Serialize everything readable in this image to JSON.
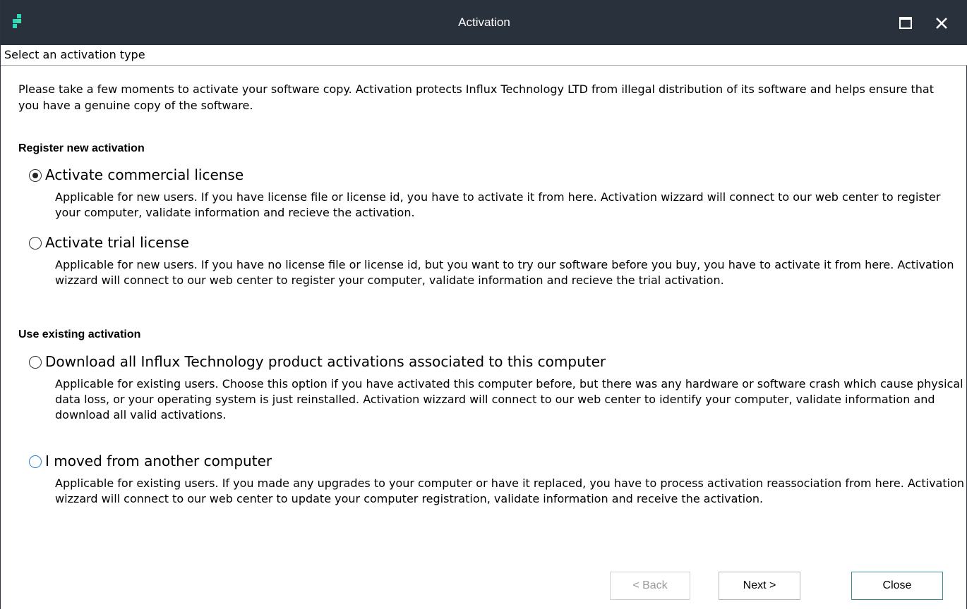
{
  "window": {
    "title": "Activation",
    "logo_icon": "app-logo-icon",
    "maximize_icon": "maximize-icon",
    "close_icon": "close-icon"
  },
  "header": {
    "subtitle": "Select an activation type"
  },
  "intro": {
    "text": "Please take a few moments to activate your software copy. Activation protects Influx Technology LTD from illegal distribution of its software and helps ensure that you have a genuine copy of the software."
  },
  "sections": {
    "register": {
      "title": "Register new activation",
      "options": [
        {
          "label": "Activate commercial license",
          "description": "Applicable for new users. If you have license file or license id, you have to activate it from here. Activation wizzard will connect to our web center to register your computer, validate information and recieve the activation.",
          "checked": true
        },
        {
          "label": "Activate trial license",
          "description": "Applicable for new users. If you have no license file or license id, but you want to try our software before you buy, you have to activate it from here. Activation wizzard will connect to our web center to register your computer, validate information and recieve the trial activation.",
          "checked": false
        }
      ]
    },
    "existing": {
      "title": "Use existing activation",
      "options": [
        {
          "label": "Download all Influx Technology product activations associated to this computer",
          "description": "Applicable for existing users. Choose this option if you have activated this computer before, but there was any hardware or software crash which cause physical data loss, or your operating system is just reinstalled. Activation wizzard will connect to our web center to identify your computer, validate information and download all valid activations.",
          "checked": false
        },
        {
          "label": "I moved from another computer",
          "description": "Applicable for existing users. If you made any upgrades to your computer or have it replaced, you have to process activation reassociation from here. Activation wizzard will connect to our web center to update your computer registration, validate information and receive the activation.",
          "checked": false,
          "focused": true
        }
      ]
    }
  },
  "buttons": {
    "back": "< Back",
    "next": "Next >",
    "close": "Close"
  },
  "colors": {
    "titlebar": "#28313c",
    "logo": "#2fd6b8",
    "focus": "#2b83d9",
    "close_button_border": "#3d8a9a"
  }
}
